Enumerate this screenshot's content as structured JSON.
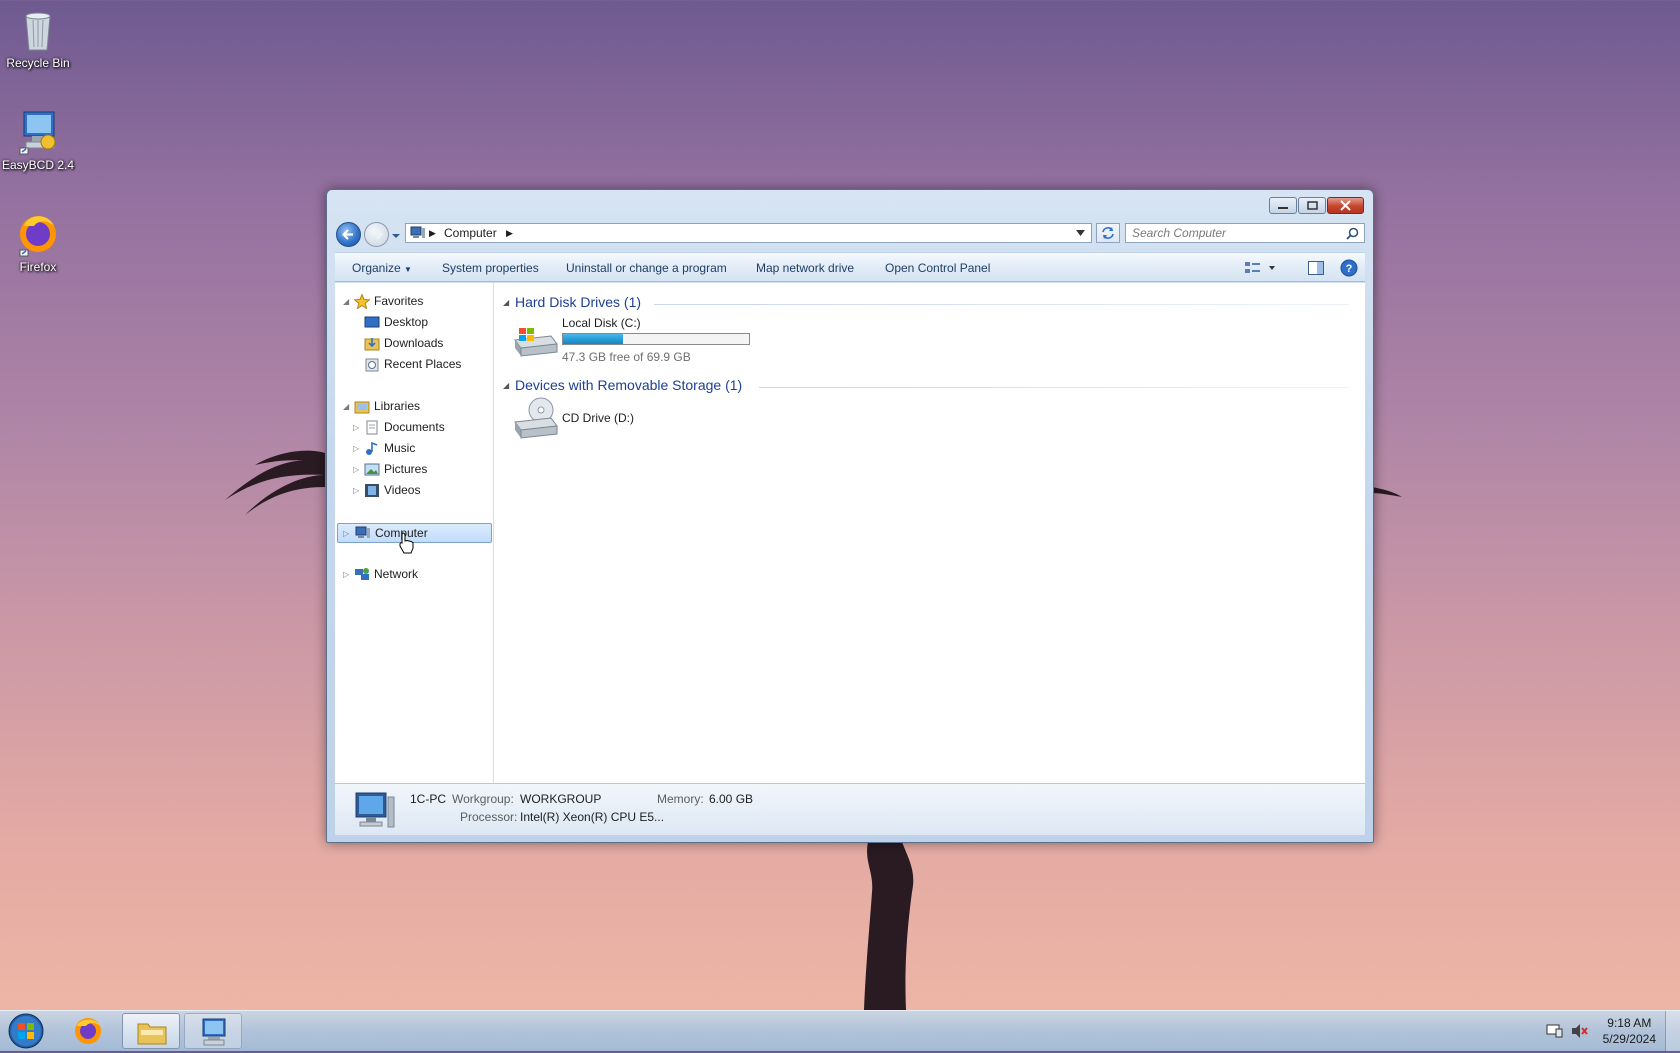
{
  "desktop": {
    "icons": [
      {
        "label": "Recycle Bin",
        "icon": "recycle-bin-icon"
      },
      {
        "label": "EasyBCD 2.4",
        "icon": "easybcd-icon"
      },
      {
        "label": "Firefox",
        "icon": "firefox-icon"
      }
    ]
  },
  "window": {
    "address": {
      "root_icon": "computer-icon",
      "segment": "Computer"
    },
    "search": {
      "placeholder": "Search Computer"
    },
    "commands": {
      "organize": "Organize",
      "system_properties": "System properties",
      "uninstall": "Uninstall or change a program",
      "map_drive": "Map network drive",
      "control_panel": "Open Control Panel"
    },
    "nav": {
      "favorites": "Favorites",
      "desktop": "Desktop",
      "downloads": "Downloads",
      "recent": "Recent Places",
      "libraries": "Libraries",
      "documents": "Documents",
      "music": "Music",
      "pictures": "Pictures",
      "videos": "Videos",
      "computer": "Computer",
      "network": "Network"
    },
    "groups": {
      "hdd_title": "Hard Disk Drives (1)",
      "removable_title": "Devices with Removable Storage (1)"
    },
    "drives": {
      "c_name": "Local Disk (C:)",
      "c_free": "47.3 GB free of 69.9 GB",
      "c_used_fraction": 0.3233,
      "d_name": "CD Drive (D:)"
    },
    "details": {
      "pc_name": "1C-PC",
      "workgroup_label": "Workgroup:",
      "workgroup": "WORKGROUP",
      "memory_label": "Memory:",
      "memory": "6.00 GB",
      "processor_label": "Processor:",
      "processor": "Intel(R) Xeon(R) CPU E5..."
    }
  },
  "taskbar": {
    "time": "9:18 AM",
    "date": "5/29/2024"
  },
  "colors": {
    "accent": "#26a0da",
    "link_blue": "#1e3f96",
    "close_red": "#c4452f"
  }
}
